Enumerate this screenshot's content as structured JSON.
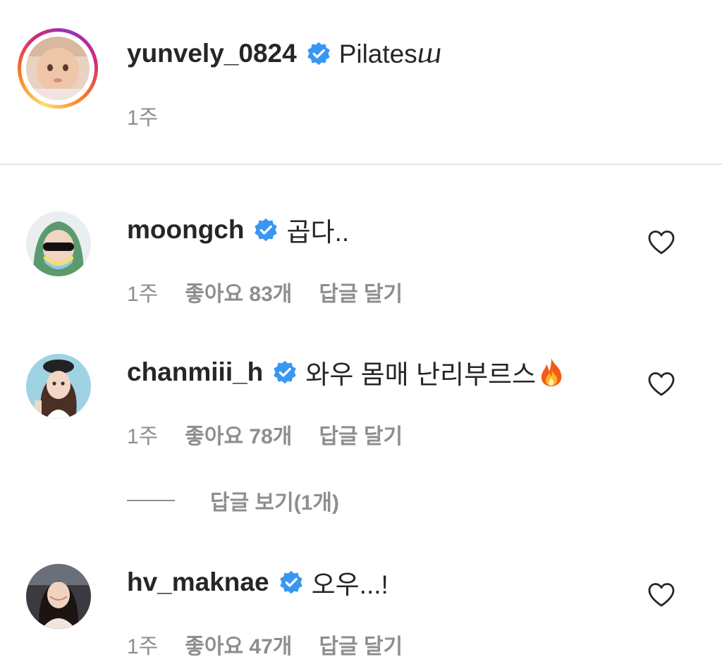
{
  "caption": {
    "username": "yunvely_0824",
    "text": "Pilatesⴍ",
    "time": "1주",
    "avatar_icon": "profile-photo",
    "story_ring_colors": [
      "#feda75",
      "#fa7e1e",
      "#d62976",
      "#962fbf"
    ]
  },
  "comments": [
    {
      "username": "moongch",
      "text": "곱다..",
      "time": "1주",
      "likes": "좋아요 83개",
      "reply": "답글 달기",
      "avatar_icon": "profile-photo"
    },
    {
      "username": "chanmiii_h",
      "text": "와우 몸매 난리부르스",
      "emoji_icon": "fire-icon",
      "time": "1주",
      "likes": "좋아요 78개",
      "reply": "답글 달기",
      "view_replies": "답글 보기(1개)",
      "avatar_icon": "profile-photo"
    },
    {
      "username": "hv_maknae",
      "text": "오우...!",
      "time": "1주",
      "likes": "좋아요 47개",
      "reply": "답글 달기",
      "avatar_icon": "profile-photo"
    }
  ],
  "colors": {
    "verified": "#3897f0",
    "text": "#262626",
    "meta": "#8e8e8e",
    "divider": "#e6e6e6"
  },
  "icons": {
    "verified": "verified-badge-icon",
    "like": "heart-outline-icon"
  }
}
